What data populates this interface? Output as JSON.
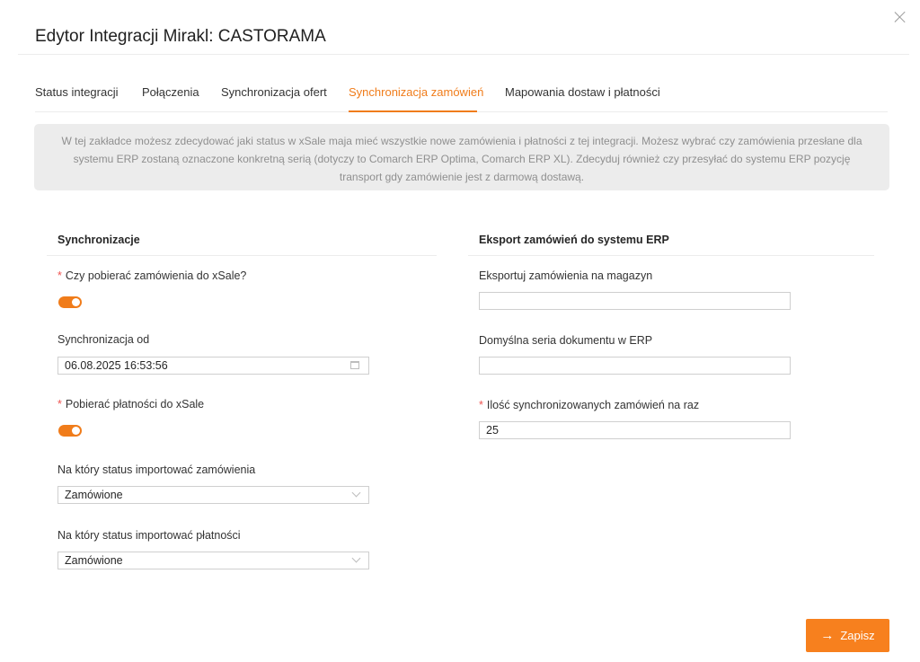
{
  "dialog": {
    "title": "Edytor Integracji Mirakl: CASTORAMA"
  },
  "tabs": [
    {
      "label": "Status integracji",
      "active": false
    },
    {
      "label": "Połączenia",
      "active": false
    },
    {
      "label": "Synchronizacja ofert",
      "active": false
    },
    {
      "label": "Synchronizacja zamówień",
      "active": true
    },
    {
      "label": "Mapowania dostaw i płatności",
      "active": false
    }
  ],
  "info": {
    "line1": "W tej zakładce możesz zdecydować jaki status w xSale maja mieć wszystkie nowe zamówienia i płatności z tej integracji. Możesz wybrać czy zamówienia przesłane dla",
    "line2": "systemu ERP zostaną oznaczone konkretną serią (dotyczy to Comarch ERP Optima, Comarch ERP XL). Zdecyduj również czy przesyłać do systemu ERP pozycję",
    "line3": "transport gdy zamówienie jest z darmową dostawą."
  },
  "left": {
    "heading": "Synchronizacje",
    "download_orders": {
      "label": "Czy pobierać zamówienia do xSale?",
      "required": "*",
      "enabled": true
    },
    "sync_from": {
      "label": "Synchronizacja od",
      "value": "06.08.2025 16:53:56",
      "icon": "calendar-icon"
    },
    "download_payments": {
      "label": "Pobierać płatności do xSale",
      "required": "*",
      "enabled": true
    },
    "order_status": {
      "label": "Na który status importować zamówienia",
      "value": "Zamówione",
      "icon": "chevron-down-icon"
    },
    "payment_status": {
      "label": "Na który status importować płatności",
      "value": "Zamówione",
      "icon": "chevron-down-icon"
    }
  },
  "right": {
    "heading": "Eksport zamówień do systemu ERP",
    "warehouse": {
      "label": "Eksportuj zamówienia na magazyn",
      "value": ""
    },
    "doc_series": {
      "label": "Domyślna seria dokumentu w ERP",
      "value": ""
    },
    "batch_size": {
      "label": "Ilość synchronizowanych zamówień na raz",
      "required": "*",
      "value": "25"
    }
  },
  "footer": {
    "save_label": "Zapisz",
    "save_icon": "arrow-right-icon"
  },
  "colors": {
    "accent": "#f07c1a",
    "info_bg": "#ececec",
    "required": "#ef5350"
  }
}
